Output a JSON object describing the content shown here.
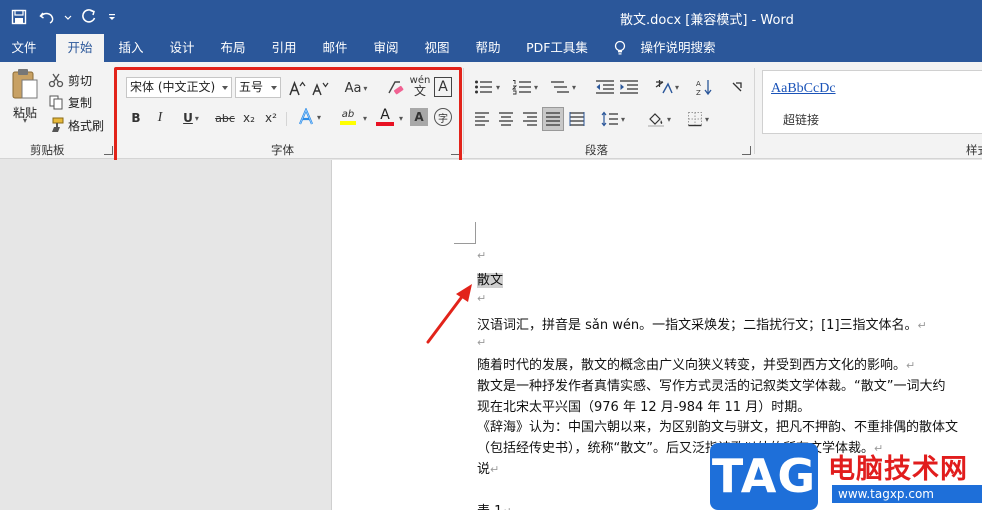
{
  "window": {
    "title": "散文.docx [兼容模式] - Word"
  },
  "quick_access": {
    "save_icon": "save-icon",
    "undo_icon": "undo-icon",
    "redo_icon": "redo-icon",
    "customize_icon": "customize-qat-icon"
  },
  "tabs": [
    {
      "label": "文件"
    },
    {
      "label": "开始"
    },
    {
      "label": "插入"
    },
    {
      "label": "设计"
    },
    {
      "label": "布局"
    },
    {
      "label": "引用"
    },
    {
      "label": "邮件"
    },
    {
      "label": "审阅"
    },
    {
      "label": "视图"
    },
    {
      "label": "帮助"
    },
    {
      "label": "PDF工具集"
    },
    {
      "label": "操作说明搜索"
    }
  ],
  "active_tab": "开始",
  "clipboard": {
    "paste": "粘贴",
    "cut": "剪切",
    "copy": "复制",
    "format_painter": "格式刷",
    "group_label": "剪贴板"
  },
  "font": {
    "font_name": "宋体 (中文正文)",
    "font_size": "五号",
    "change_case": "Aa",
    "phonetic": "wén",
    "phonetic_char": "文",
    "border_char": "A",
    "bold": "B",
    "italic": "I",
    "underline": "U",
    "strikethrough": "abc",
    "subscript": "x₂",
    "superscript": "x²",
    "highlight": "ab",
    "font_color": "A",
    "shading": "A",
    "enclose": "字",
    "group_label": "字体"
  },
  "paragraph": {
    "group_label": "段落"
  },
  "styles": {
    "sample": "AaBbCcDc",
    "name": "超链接",
    "group_label": "样式"
  },
  "document": {
    "title": "散文",
    "lines": [
      "汉语词汇，拼音是 sǎn wén。一指文采焕发；二指扰行文；[1]三指文体名。",
      "随着时代的发展，散文的概念由广义向狭义转变，并受到西方文化的影响。",
      "散文是一种抒发作者真情实感、写作方式灵活的记叙类文学体裁。“散文”一词大约",
      "现在北宋太平兴国（976 年 12 月-984 年 11 月）时期。",
      "《辞海》认为：中国六朝以来，为区别韵文与骈文，把凡不押韵、不重排偶的散体文",
      "（包括经传史书），统称“散文”。后又泛指诗歌以外的所有文学体裁。",
      "说",
      "表 1"
    ],
    "paragraph_mark": "↵"
  },
  "watermark": {
    "logo": "TAG",
    "title": "电脑技术网",
    "url": "www.tagxp.com"
  },
  "colors": {
    "brand": "#2b579a",
    "highlight_box": "#e2231a",
    "font_color_bar": "#e81123",
    "highlight_bar": "#ffff00"
  }
}
